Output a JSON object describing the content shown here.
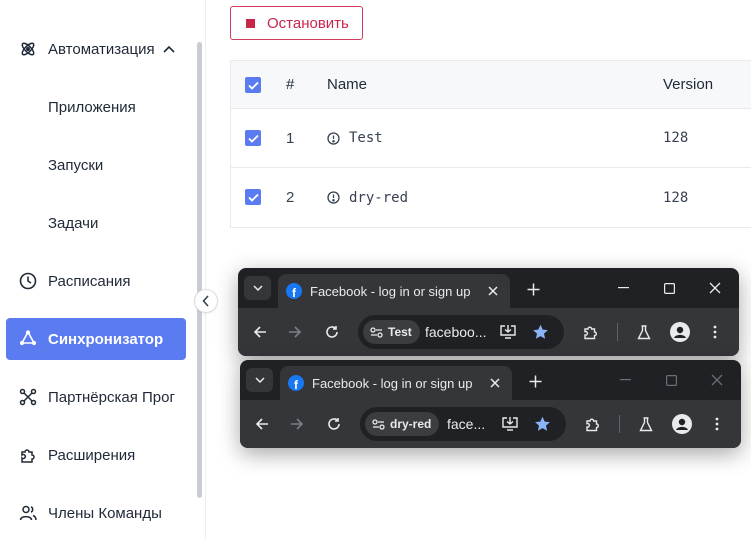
{
  "sidebar": {
    "items": [
      {
        "label": "Автоматизация",
        "icon": "atom-icon"
      },
      {
        "label": "Приложения"
      },
      {
        "label": "Запуски"
      },
      {
        "label": "Задачи"
      },
      {
        "label": "Расписания",
        "icon": "clock-icon"
      },
      {
        "label": "Синхронизатор",
        "icon": "sync-icon"
      },
      {
        "label": "Партнёрская Прог",
        "icon": "network-icon"
      },
      {
        "label": "Расширения",
        "icon": "puzzle-icon"
      },
      {
        "label": "Члены Команды",
        "icon": "users-icon"
      }
    ]
  },
  "toolbar": {
    "stop_label": "Остановить"
  },
  "table": {
    "headers": {
      "num": "#",
      "name": "Name",
      "version": "Version"
    },
    "rows": [
      {
        "num": "1",
        "name": "Test",
        "version": "128"
      },
      {
        "num": "2",
        "name": "dry-red",
        "version": "128"
      }
    ]
  },
  "browsers": [
    {
      "tab_title": "Facebook - log in or sign up",
      "profile": "Test",
      "url": "faceboo..."
    },
    {
      "tab_title": "Facebook - log in or sign up",
      "profile": "dry-red",
      "url": "face..."
    }
  ],
  "colors": {
    "accent": "#5b7cf0",
    "danger": "#c8254a",
    "chrome_dark": "#202124",
    "chrome_toolbar": "#35363a"
  }
}
